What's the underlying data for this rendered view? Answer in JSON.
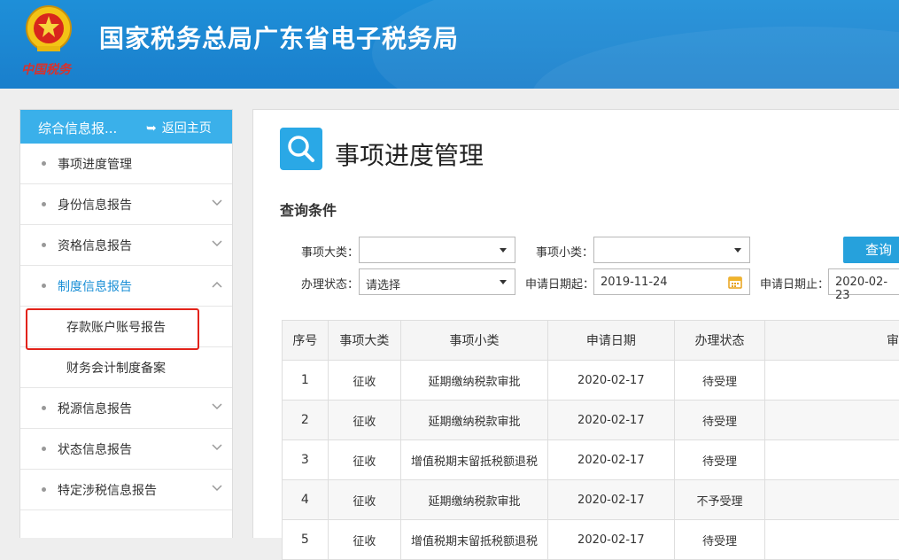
{
  "header": {
    "site_title": "国家税务总局广东省电子税务局",
    "emblem_caption": "中国税务"
  },
  "sidebar": {
    "title": "综合信息报...",
    "back_label": "返回主页",
    "items": [
      {
        "label": "事项进度管理",
        "has_chevron": false
      },
      {
        "label": "身份信息报告",
        "has_chevron": true
      },
      {
        "label": "资格信息报告",
        "has_chevron": true
      },
      {
        "label": "制度信息报告",
        "has_chevron": true,
        "expanded": true
      },
      {
        "label": "税源信息报告",
        "has_chevron": true
      },
      {
        "label": "状态信息报告",
        "has_chevron": true
      },
      {
        "label": "特定涉税信息报告",
        "has_chevron": true
      }
    ],
    "sub_items": [
      {
        "label": "存款账户账号报告",
        "highlighted": true
      },
      {
        "label": "财务会计制度备案"
      }
    ]
  },
  "main": {
    "page_title": "事项进度管理",
    "section_title": "查询条件",
    "filters": {
      "category_label": "事项大类：",
      "category_value": "",
      "subcategory_label": "事项小类：",
      "subcategory_value": "",
      "status_label": "办理状态：",
      "status_value": "请选择",
      "date_from_label": "申请日期起：",
      "date_from_value": "2019-11-24",
      "date_to_label": "申请日期止：",
      "date_to_value": "2020-02-23"
    },
    "query_button": "查询",
    "table": {
      "headers": [
        "序号",
        "事项大类",
        "事项小类",
        "申请日期",
        "办理状态",
        "审"
      ],
      "rows": [
        [
          "1",
          "征收",
          "延期缴纳税款审批",
          "2020-02-17",
          "待受理",
          ""
        ],
        [
          "2",
          "征收",
          "延期缴纳税款审批",
          "2020-02-17",
          "待受理",
          ""
        ],
        [
          "3",
          "征收",
          "增值税期末留抵税额退税",
          "2020-02-17",
          "待受理",
          ""
        ],
        [
          "4",
          "征收",
          "延期缴纳税款审批",
          "2020-02-17",
          "不予受理",
          ""
        ],
        [
          "5",
          "征收",
          "增值税期末留抵税额退税",
          "2020-02-17",
          "待受理",
          ""
        ]
      ]
    }
  },
  "colors": {
    "header_blue": "#1a7fcc",
    "sidebar_head": "#3ab0ea",
    "accent_blue": "#26a1dc",
    "highlight_red": "#e2231a"
  }
}
